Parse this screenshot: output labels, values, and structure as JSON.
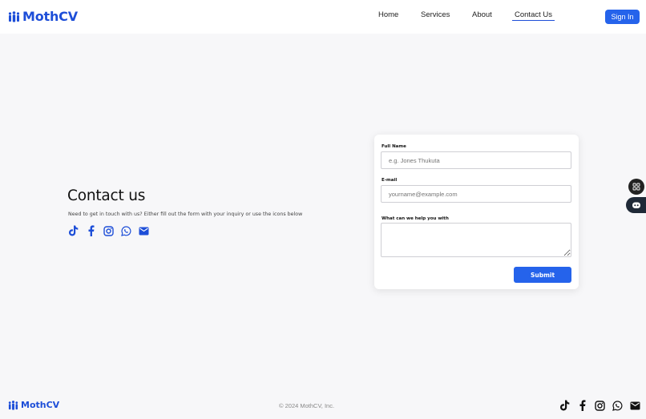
{
  "brand": {
    "name": "MothCV"
  },
  "nav": {
    "items": [
      {
        "label": "Home"
      },
      {
        "label": "Services"
      },
      {
        "label": "About"
      },
      {
        "label": "Contact Us",
        "active": true
      }
    ],
    "signin_label": "Sign In"
  },
  "contact": {
    "title": "Contact us",
    "description": "Need to get in touch with us? Either fill out the form with your inquiry or use the icons below",
    "social_icons": [
      "tiktok-icon",
      "facebook-icon",
      "instagram-icon",
      "whatsapp-icon",
      "mail-icon"
    ]
  },
  "form": {
    "full_name_label": "Full Name",
    "full_name_placeholder": "e.g. Jones Thukuta",
    "email_label": "E-mail",
    "email_placeholder": "yourname@example.com",
    "message_label": "What can we help you with",
    "submit_label": "Submit"
  },
  "footer": {
    "brand": "MothCV",
    "copyright": "© 2024 MothCV, Inc."
  },
  "colors": {
    "accent": "#2563eb",
    "brand": "#1d4ed8",
    "background": "#f7f7f9"
  }
}
